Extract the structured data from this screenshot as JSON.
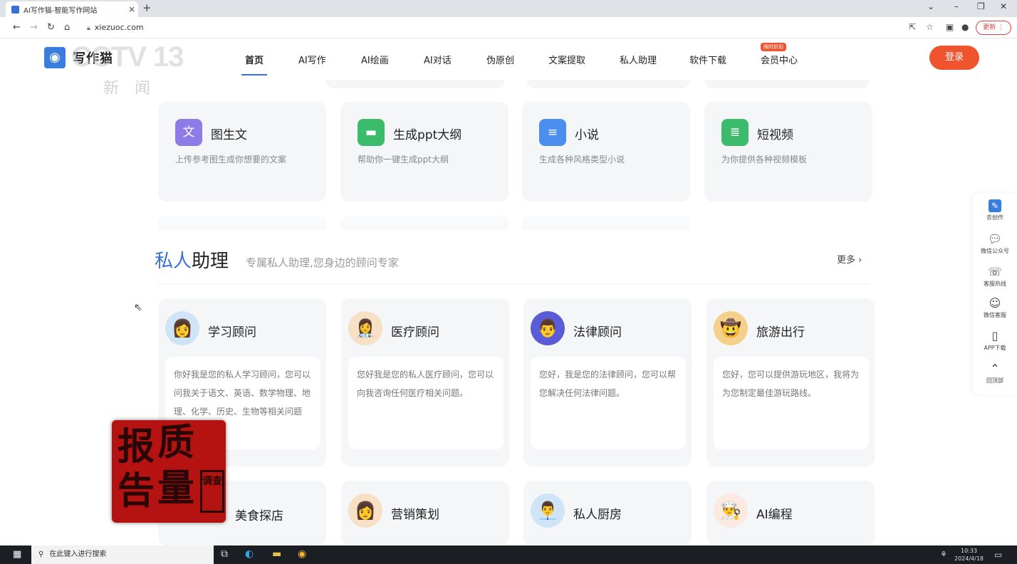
{
  "browser": {
    "tab_title": "AI写作猫-智能写作网站",
    "tab_close": "×",
    "new_tab": "+",
    "url": "xiezuoc.com",
    "update_label": "更新 ⋮",
    "win_controls": [
      "⌄",
      "–",
      "❐",
      "✕"
    ]
  },
  "header": {
    "logo_text": "写作猫",
    "watermark_text": "CCTV 13",
    "watermark_sub": "新闻",
    "nav": [
      {
        "label": "首页"
      },
      {
        "label": "AI写作"
      },
      {
        "label": "AI绘画"
      },
      {
        "label": "AI对话"
      },
      {
        "label": "伪原创"
      },
      {
        "label": "文案提取"
      },
      {
        "label": "私人助理"
      },
      {
        "label": "软件下载"
      },
      {
        "label": "会员中心"
      }
    ],
    "member_badge": "限时折扣",
    "login_label": "登录"
  },
  "tools": [
    {
      "title": "图生文",
      "desc": "上传参考图生成你想要的文案",
      "color": "#8f7be8",
      "icon": "image-text-icon"
    },
    {
      "title": "生成ppt大纲",
      "desc": "帮助你一键生成ppt大纲",
      "color": "#3dbb6c",
      "icon": "bookmark-icon"
    },
    {
      "title": "小说",
      "desc": "生成各种风格类型小说",
      "color": "#4b8ef0",
      "icon": "document-icon"
    },
    {
      "title": "短视频",
      "desc": "为你提供各种视频模板",
      "color": "#3dbb6c",
      "icon": "list-document-icon"
    }
  ],
  "assistant_section": {
    "title_highlight": "私人",
    "title_rest": "助理",
    "subtitle": "专属私人助理,您身边的顾问专家",
    "more_label": "更多 ›",
    "cards": [
      {
        "title": "学习顾问",
        "desc": "你好我是您的私人学习顾问，您可以问我关于语文、英语、数学物理、地理、化学、历史、生物等相关问题哦。"
      },
      {
        "title": "医疗顾问",
        "desc": "您好我是您的私人医疗顾问，您可以向我咨询任何医疗相关问题。"
      },
      {
        "title": "法律顾问",
        "desc": "您好，我是您的法律顾问，您可以帮您解决任何法律问题。"
      },
      {
        "title": "旅游出行",
        "desc": "您好，您可以提供游玩地区，我将为为您制定最佳游玩路线。"
      }
    ],
    "cards_row2": [
      {
        "title": "美食探店"
      },
      {
        "title": "营销策划"
      },
      {
        "title": "私人厨房"
      },
      {
        "title": "AI编程"
      }
    ]
  },
  "sidebar": {
    "items": [
      {
        "label": "去创作",
        "icon": "pencil-icon"
      },
      {
        "label": "微信公众号",
        "icon": "chat-icon"
      },
      {
        "label": "客服热线",
        "icon": "phone-icon"
      },
      {
        "label": "微信客服",
        "icon": "smile-icon"
      },
      {
        "label": "APP下载",
        "icon": "phone-device-icon"
      },
      {
        "label": "回顶部",
        "icon": "arrow-up-icon"
      }
    ]
  },
  "overlay": {
    "stamp_chars": [
      "报",
      "质",
      "告",
      "量"
    ],
    "stamp_mini": "调查"
  },
  "taskbar": {
    "search_placeholder": "在此键入进行搜索",
    "time": "10:33",
    "date": "2024/4/18"
  }
}
